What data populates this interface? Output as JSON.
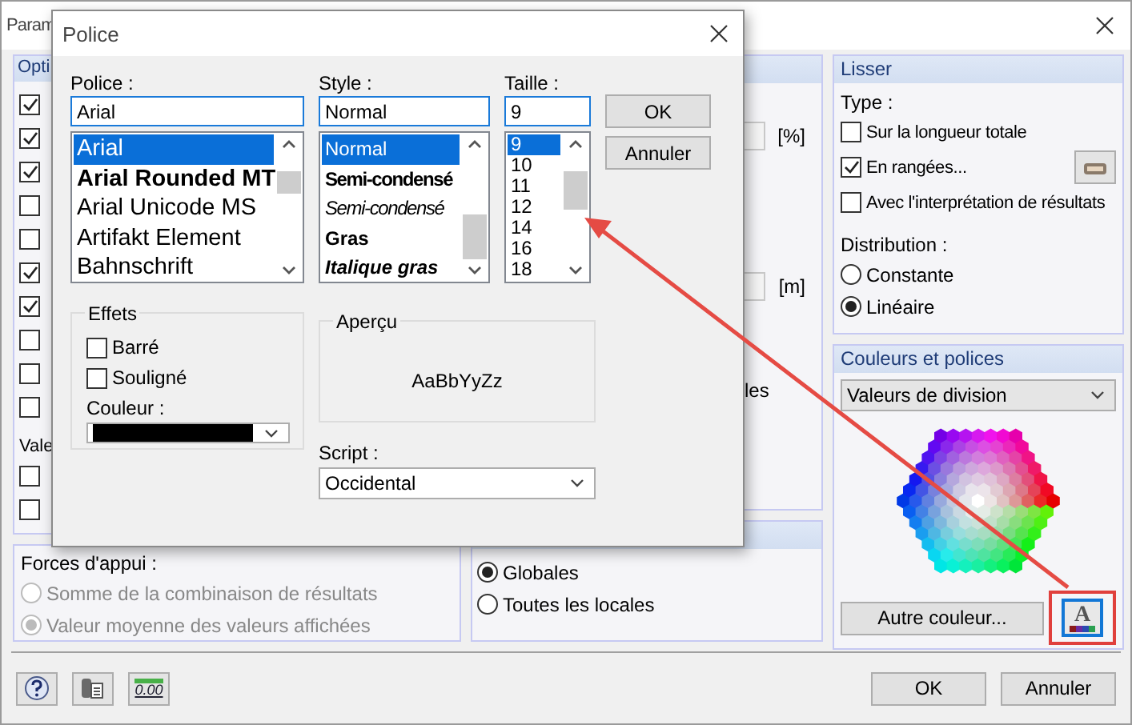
{
  "window": {
    "title": "Param"
  },
  "options_panel": {
    "title": "Opti",
    "items": [
      {
        "checked": true
      },
      {
        "checked": true
      },
      {
        "checked": true
      },
      {
        "checked": false
      },
      {
        "checked": false
      },
      {
        "checked": true
      },
      {
        "checked": true
      },
      {
        "checked": false
      },
      {
        "checked": false
      },
      {
        "checked": false
      }
    ]
  },
  "values_panel": {
    "title": "Vale",
    "items": [
      {
        "checked": false
      },
      {
        "checked": false
      }
    ]
  },
  "support_forces": {
    "title": "Forces d'appui :",
    "options": [
      {
        "label": "Somme de la combinaison de résultats",
        "selected": false,
        "disabled": true
      },
      {
        "label": "Valeur moyenne des valeurs affichées",
        "selected": true,
        "disabled": true
      }
    ]
  },
  "middle_panel": {
    "units": [
      "[%]",
      "[m]"
    ],
    "fragment": "les"
  },
  "axes_panel": {
    "options": [
      {
        "label": "Globales",
        "selected": true
      },
      {
        "label": "Toutes les locales",
        "selected": false
      }
    ]
  },
  "smooth_panel": {
    "title": "Lisser",
    "type_label": "Type :",
    "checks": [
      {
        "label": "Sur la longueur totale",
        "checked": false
      },
      {
        "label": "En rangées...",
        "checked": true
      },
      {
        "label": "Avec l'interprétation de résultats",
        "checked": false
      }
    ],
    "distribution_label": "Distribution :",
    "distribution": [
      {
        "label": "Constante",
        "selected": false
      },
      {
        "label": "Linéaire",
        "selected": true
      }
    ]
  },
  "colors_panel": {
    "title": "Couleurs et polices",
    "dropdown": "Valeurs de division",
    "button": "Autre couleur...",
    "font_button": "A"
  },
  "tool_buttons": {
    "decimal": "0.00"
  },
  "buttons": [
    "OK",
    "Annuler"
  ],
  "font_dialog": {
    "title": "Police",
    "font": {
      "label": "Police :",
      "value": "Arial",
      "items": [
        {
          "label": "Arial",
          "selected": true
        },
        {
          "label": "Arial Rounded MT",
          "selected": false
        },
        {
          "label": "Arial Unicode MS",
          "selected": false
        },
        {
          "label": "Artifakt Element",
          "selected": false
        },
        {
          "label": "Bahnschrift",
          "selected": false
        }
      ]
    },
    "style": {
      "label": "Style :",
      "value": "Normal",
      "items": [
        {
          "label": "Normal",
          "selected": true
        },
        {
          "label": "Semi-condensé",
          "selected": false
        },
        {
          "label": "Semi-condensé",
          "selected": false
        },
        {
          "label": "Gras",
          "selected": false
        },
        {
          "label": "Italique gras",
          "selected": false
        }
      ]
    },
    "size": {
      "label": "Taille :",
      "value": "9",
      "items": [
        {
          "label": "9",
          "selected": true
        },
        {
          "label": "10",
          "selected": false
        },
        {
          "label": "11",
          "selected": false
        },
        {
          "label": "12",
          "selected": false
        },
        {
          "label": "14",
          "selected": false
        },
        {
          "label": "16",
          "selected": false
        },
        {
          "label": "18",
          "selected": false
        }
      ]
    },
    "buttons": [
      "OK",
      "Annuler"
    ],
    "effects": {
      "title": "Effets",
      "items": [
        {
          "label": "Barré",
          "checked": false
        },
        {
          "label": "Souligné",
          "checked": false
        }
      ],
      "color_label": "Couleur :"
    },
    "preview": {
      "title": "Aperçu",
      "sample": "AaBbYyZz"
    },
    "script": {
      "label": "Script :",
      "value": "Occidental"
    }
  }
}
